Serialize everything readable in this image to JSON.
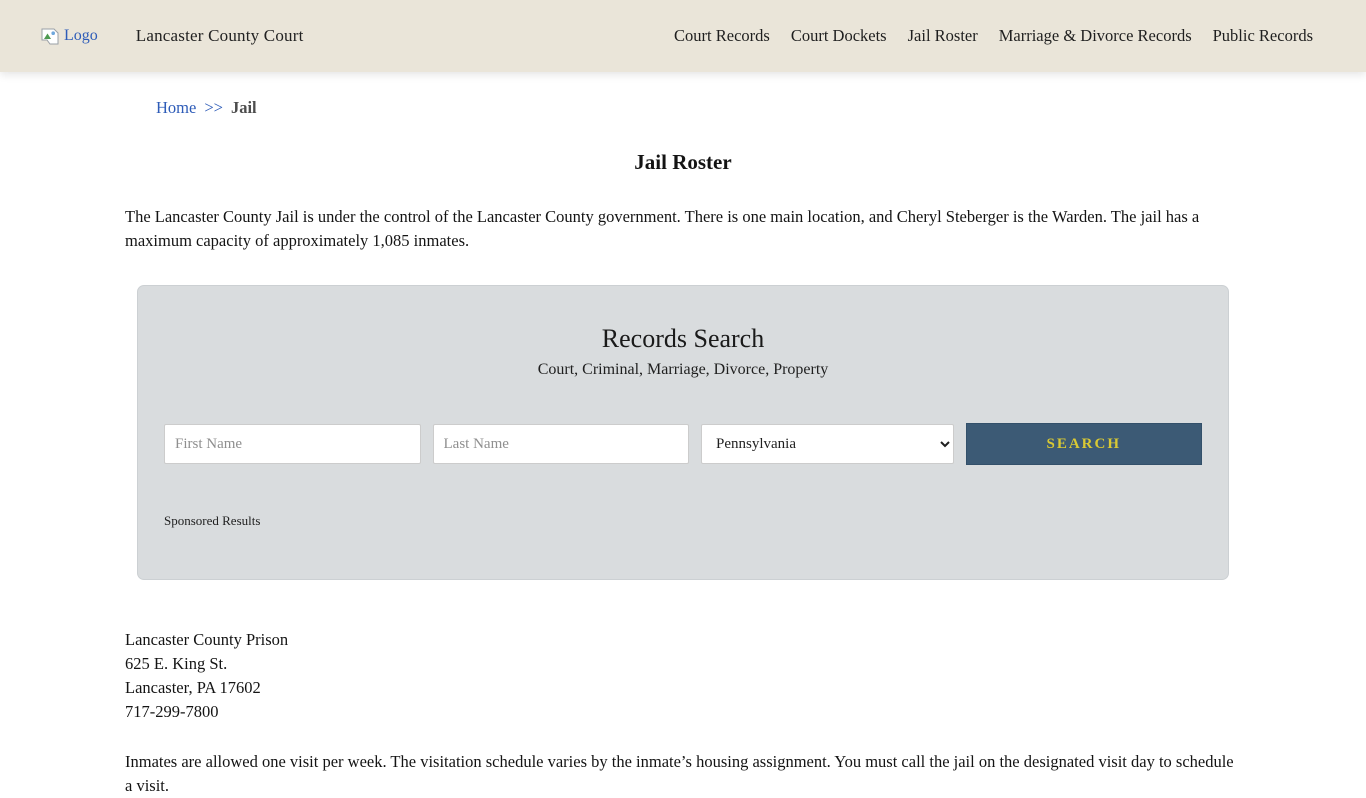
{
  "header": {
    "logo_alt": "Logo",
    "site_title": "Lancaster County Court",
    "nav": [
      {
        "label": "Court Records"
      },
      {
        "label": "Court Dockets"
      },
      {
        "label": "Jail Roster"
      },
      {
        "label": "Marriage & Divorce Records"
      },
      {
        "label": "Public Records"
      }
    ]
  },
  "breadcrumb": {
    "home": "Home",
    "separator": ">>",
    "current": "Jail"
  },
  "page": {
    "title": "Jail Roster",
    "intro": "The Lancaster County Jail is under the control of the Lancaster County government. There is one main location, and Cheryl Steberger is the Warden. The jail has a maximum capacity of approximately 1,085 inmates.",
    "visitation": "Inmates are allowed one visit per week. The visitation schedule varies by the inmate’s housing assignment. You must call the jail on the designated visit day to schedule a visit."
  },
  "search": {
    "title": "Records Search",
    "subtitle": "Court, Criminal, Marriage, Divorce, Property",
    "first_name_placeholder": "First Name",
    "last_name_placeholder": "Last Name",
    "state_selected": "Pennsylvania",
    "button_label": "SEARCH",
    "sponsored_label": "Sponsored Results"
  },
  "address": {
    "lines": [
      "Lancaster County Prison",
      "625 E. King St.",
      "Lancaster, PA 17602",
      "717-299-7800"
    ]
  },
  "colors": {
    "header-bg": "#eae5d9",
    "link-blue": "#2e5cb8",
    "button-bg": "#3c5a75",
    "button-text": "#d9c934",
    "panel-bg": "#d9dcde"
  }
}
